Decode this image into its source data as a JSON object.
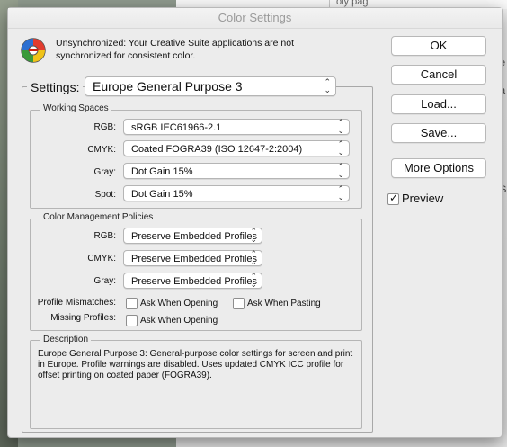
{
  "dialog": {
    "title": "Color Settings",
    "sync_message": "Unsynchronized: Your Creative Suite applications are not synchronized for consistent color.",
    "settings_label": "Settings:",
    "settings_value": "Europe General Purpose 3"
  },
  "working_spaces": {
    "title": "Working Spaces",
    "rgb_label": "RGB:",
    "rgb_value": "sRGB IEC61966-2.1",
    "cmyk_label": "CMYK:",
    "cmyk_value": "Coated FOGRA39 (ISO 12647-2:2004)",
    "gray_label": "Gray:",
    "gray_value": "Dot Gain 15%",
    "spot_label": "Spot:",
    "spot_value": "Dot Gain 15%"
  },
  "policies": {
    "title": "Color Management Policies",
    "rgb_label": "RGB:",
    "rgb_value": "Preserve Embedded Profiles",
    "cmyk_label": "CMYK:",
    "cmyk_value": "Preserve Embedded Profiles",
    "gray_label": "Gray:",
    "gray_value": "Preserve Embedded Profiles",
    "mismatch_label": "Profile Mismatches:",
    "ask_opening": "Ask When Opening",
    "ask_pasting": "Ask When Pasting",
    "missing_label": "Missing Profiles:",
    "missing_ask_opening": "Ask When Opening"
  },
  "description": {
    "title": "Description",
    "text": "Europe General Purpose 3:  General-purpose color settings for screen and print in Europe. Profile warnings are disabled. Uses updated CMYK ICC profile for offset printing on coated paper (FOGRA39)."
  },
  "buttons": {
    "ok": "OK",
    "cancel": "Cancel",
    "load": "Load...",
    "save": "Save...",
    "more_options": "More Options",
    "preview": "Preview"
  },
  "state": {
    "preview_checked": true,
    "mismatch_ask_opening": false,
    "mismatch_ask_pasting": false,
    "missing_ask_opening": false
  },
  "background": {
    "top_fragment": "oly pag",
    "right_fragments": [
      "e",
      "a",
      "S"
    ]
  }
}
